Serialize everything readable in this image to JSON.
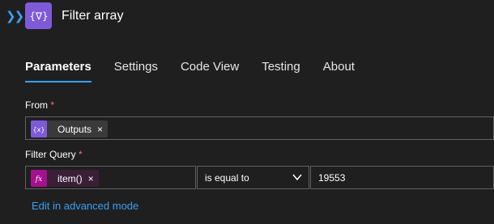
{
  "header": {
    "title": "Filter array",
    "expand_icon": "double-chevron-right-icon",
    "action_icon": "filter-array-icon",
    "action_icon_color": "#7f5ad8"
  },
  "tabs": [
    {
      "label": "Parameters",
      "active": true
    },
    {
      "label": "Settings",
      "active": false
    },
    {
      "label": "Code View",
      "active": false
    },
    {
      "label": "Testing",
      "active": false
    },
    {
      "label": "About",
      "active": false
    }
  ],
  "from": {
    "label": "From",
    "required_mark": "*",
    "token": {
      "label": "Outputs",
      "remove": "×",
      "icon": "variable-icon",
      "color": "#7f5ad8"
    }
  },
  "filter_query": {
    "label": "Filter Query",
    "required_mark": "*",
    "token": {
      "label": "item()",
      "remove": "×",
      "icon": "fx-icon",
      "color": "#a4108e"
    },
    "operator": "is equal to",
    "value": "19553"
  },
  "advanced_link": "Edit in advanced mode",
  "colors": {
    "accent": "#3aa0f3",
    "background": "#1f1f1f",
    "required": "#ff6b6b"
  }
}
